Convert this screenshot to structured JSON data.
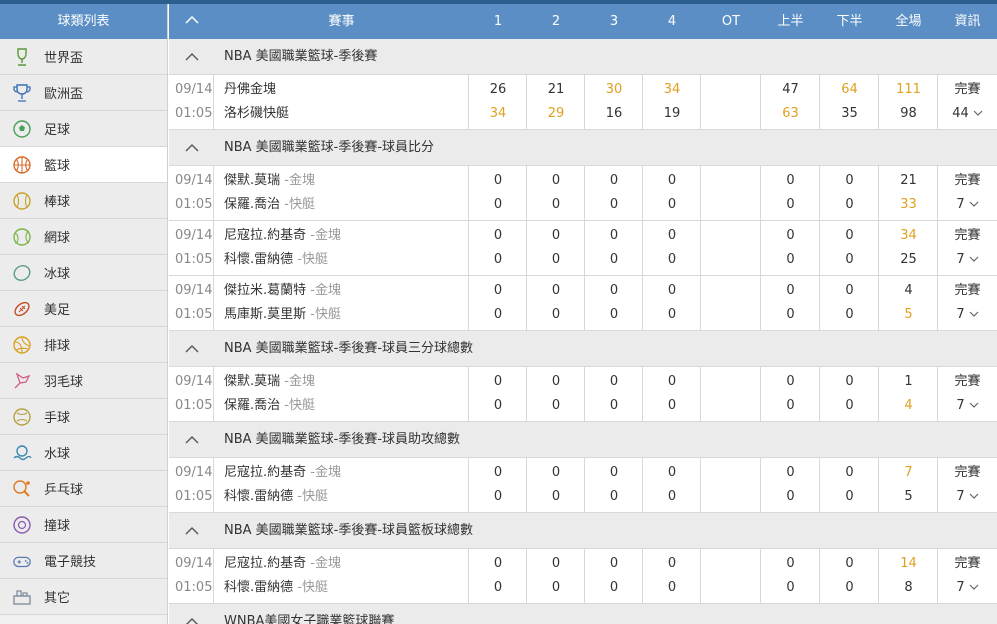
{
  "sidebar": {
    "title": "球類列表",
    "items": [
      {
        "label": "世界盃",
        "icon": "world-cup-icon"
      },
      {
        "label": "歐洲盃",
        "icon": "euro-cup-icon"
      },
      {
        "label": "足球",
        "icon": "football-icon"
      },
      {
        "label": "籃球",
        "icon": "basketball-icon",
        "active": true
      },
      {
        "label": "棒球",
        "icon": "baseball-icon"
      },
      {
        "label": "網球",
        "icon": "tennis-icon"
      },
      {
        "label": "冰球",
        "icon": "hockey-icon"
      },
      {
        "label": "美足",
        "icon": "american-football-icon"
      },
      {
        "label": "排球",
        "icon": "volleyball-icon"
      },
      {
        "label": "羽毛球",
        "icon": "badminton-icon"
      },
      {
        "label": "手球",
        "icon": "handball-icon"
      },
      {
        "label": "水球",
        "icon": "water-polo-icon"
      },
      {
        "label": "乒乓球",
        "icon": "table-tennis-icon"
      },
      {
        "label": "撞球",
        "icon": "billiards-icon"
      },
      {
        "label": "電子競技",
        "icon": "esports-icon"
      },
      {
        "label": "其它",
        "icon": "other-icon"
      }
    ]
  },
  "header": {
    "event": "賽事",
    "q1": "1",
    "q2": "2",
    "q3": "3",
    "q4": "4",
    "ot": "OT",
    "first_half": "上半",
    "second_half": "下半",
    "full": "全場",
    "info": "資訊"
  },
  "colors": {
    "accent": "#5b8ec4",
    "highlight": "#e0a020"
  },
  "sections": [
    {
      "title": "NBA 美國職業籃球-季後賽",
      "matches": [
        {
          "date": "09/14",
          "time": "01:05",
          "home": {
            "name": "丹佛金塊",
            "side": "",
            "q": [
              "26",
              "21",
              "30",
              "34"
            ],
            "qh": [
              false,
              false,
              true,
              true
            ],
            "ot": "",
            "h1": "47",
            "h1h": false,
            "h2": "64",
            "h2h": true,
            "ft": "111",
            "fth": true
          },
          "away": {
            "name": "洛杉磯快艇",
            "side": "",
            "q": [
              "34",
              "29",
              "16",
              "19"
            ],
            "qh": [
              true,
              true,
              false,
              false
            ],
            "ot": "",
            "h1": "63",
            "h1h": true,
            "h2": "35",
            "h2h": false,
            "ft": "98",
            "fth": false
          },
          "status": "完賽",
          "count": "44"
        }
      ]
    },
    {
      "title": "NBA 美國職業籃球-季後賽-球員比分",
      "matches": [
        {
          "date": "09/14",
          "time": "01:05",
          "home": {
            "name": "傑默.莫瑞",
            "side": " -金塊",
            "q": [
              "0",
              "0",
              "0",
              "0"
            ],
            "qh": [
              false,
              false,
              false,
              false
            ],
            "ot": "",
            "h1": "0",
            "h1h": false,
            "h2": "0",
            "h2h": false,
            "ft": "21",
            "fth": false
          },
          "away": {
            "name": "保羅.喬治",
            "side": " -快艇",
            "q": [
              "0",
              "0",
              "0",
              "0"
            ],
            "qh": [
              false,
              false,
              false,
              false
            ],
            "ot": "",
            "h1": "0",
            "h1h": false,
            "h2": "0",
            "h2h": false,
            "ft": "33",
            "fth": true
          },
          "status": "完賽",
          "count": "7"
        },
        {
          "date": "09/14",
          "time": "01:05",
          "home": {
            "name": "尼寇拉.約基奇",
            "side": " -金塊",
            "q": [
              "0",
              "0",
              "0",
              "0"
            ],
            "qh": [
              false,
              false,
              false,
              false
            ],
            "ot": "",
            "h1": "0",
            "h1h": false,
            "h2": "0",
            "h2h": false,
            "ft": "34",
            "fth": true
          },
          "away": {
            "name": "科懷.雷納德",
            "side": " -快艇",
            "q": [
              "0",
              "0",
              "0",
              "0"
            ],
            "qh": [
              false,
              false,
              false,
              false
            ],
            "ot": "",
            "h1": "0",
            "h1h": false,
            "h2": "0",
            "h2h": false,
            "ft": "25",
            "fth": false
          },
          "status": "完賽",
          "count": "7"
        },
        {
          "date": "09/14",
          "time": "01:05",
          "home": {
            "name": "傑拉米.葛蘭特",
            "side": " -金塊",
            "q": [
              "0",
              "0",
              "0",
              "0"
            ],
            "qh": [
              false,
              false,
              false,
              false
            ],
            "ot": "",
            "h1": "0",
            "h1h": false,
            "h2": "0",
            "h2h": false,
            "ft": "4",
            "fth": false
          },
          "away": {
            "name": "馬庫斯.莫里斯",
            "side": " -快艇",
            "q": [
              "0",
              "0",
              "0",
              "0"
            ],
            "qh": [
              false,
              false,
              false,
              false
            ],
            "ot": "",
            "h1": "0",
            "h1h": false,
            "h2": "0",
            "h2h": false,
            "ft": "5",
            "fth": true
          },
          "status": "完賽",
          "count": "7"
        }
      ]
    },
    {
      "title": "NBA 美國職業籃球-季後賽-球員三分球總數",
      "matches": [
        {
          "date": "09/14",
          "time": "01:05",
          "home": {
            "name": "傑默.莫瑞",
            "side": " -金塊",
            "q": [
              "0",
              "0",
              "0",
              "0"
            ],
            "qh": [
              false,
              false,
              false,
              false
            ],
            "ot": "",
            "h1": "0",
            "h1h": false,
            "h2": "0",
            "h2h": false,
            "ft": "1",
            "fth": false
          },
          "away": {
            "name": "保羅.喬治",
            "side": " -快艇",
            "q": [
              "0",
              "0",
              "0",
              "0"
            ],
            "qh": [
              false,
              false,
              false,
              false
            ],
            "ot": "",
            "h1": "0",
            "h1h": false,
            "h2": "0",
            "h2h": false,
            "ft": "4",
            "fth": true
          },
          "status": "完賽",
          "count": "7"
        }
      ]
    },
    {
      "title": "NBA 美國職業籃球-季後賽-球員助攻總數",
      "matches": [
        {
          "date": "09/14",
          "time": "01:05",
          "home": {
            "name": "尼寇拉.約基奇",
            "side": " -金塊",
            "q": [
              "0",
              "0",
              "0",
              "0"
            ],
            "qh": [
              false,
              false,
              false,
              false
            ],
            "ot": "",
            "h1": "0",
            "h1h": false,
            "h2": "0",
            "h2h": false,
            "ft": "7",
            "fth": true
          },
          "away": {
            "name": "科懷.雷納德",
            "side": " -快艇",
            "q": [
              "0",
              "0",
              "0",
              "0"
            ],
            "qh": [
              false,
              false,
              false,
              false
            ],
            "ot": "",
            "h1": "0",
            "h1h": false,
            "h2": "0",
            "h2h": false,
            "ft": "5",
            "fth": false
          },
          "status": "完賽",
          "count": "7"
        }
      ]
    },
    {
      "title": "NBA 美國職業籃球-季後賽-球員籃板球總數",
      "matches": [
        {
          "date": "09/14",
          "time": "01:05",
          "home": {
            "name": "尼寇拉.約基奇",
            "side": " -金塊",
            "q": [
              "0",
              "0",
              "0",
              "0"
            ],
            "qh": [
              false,
              false,
              false,
              false
            ],
            "ot": "",
            "h1": "0",
            "h1h": false,
            "h2": "0",
            "h2h": false,
            "ft": "14",
            "fth": true
          },
          "away": {
            "name": "科懷.雷納德",
            "side": " -快艇",
            "q": [
              "0",
              "0",
              "0",
              "0"
            ],
            "qh": [
              false,
              false,
              false,
              false
            ],
            "ot": "",
            "h1": "0",
            "h1h": false,
            "h2": "0",
            "h2h": false,
            "ft": "8",
            "fth": false
          },
          "status": "完賽",
          "count": "7"
        }
      ]
    },
    {
      "title": "WNBA美國女子職業籃球聯賽",
      "matches": []
    }
  ]
}
